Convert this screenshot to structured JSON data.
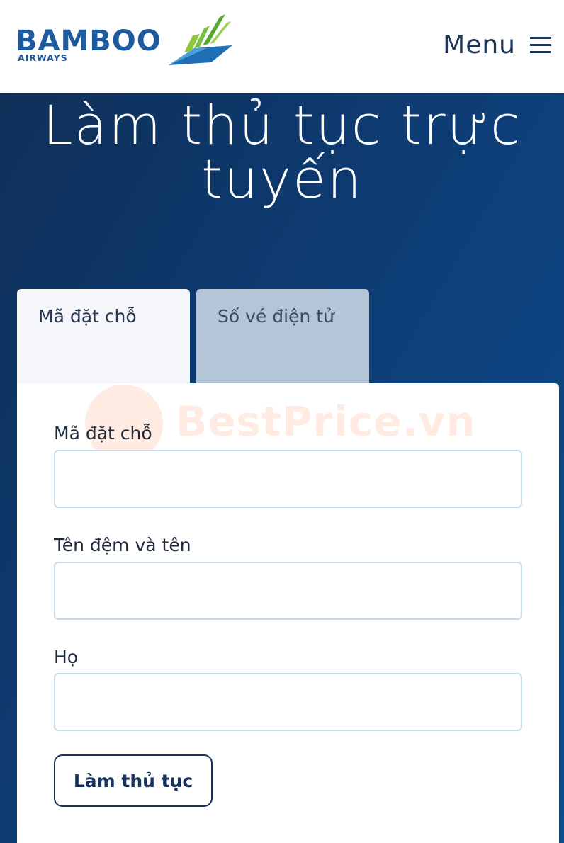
{
  "header": {
    "logo_word": "BAMBOO",
    "logo_sub": "AIRWAYS",
    "menu_label": "Menu"
  },
  "hero": {
    "title_line1": "Làm thủ tục trực",
    "title_line2": "tuyến"
  },
  "tabs": [
    {
      "label": "Mã đặt chỗ",
      "active": true
    },
    {
      "label": "Số vé điện tử",
      "active": false
    }
  ],
  "watermark": {
    "text": "BestPrice.vn"
  },
  "form": {
    "fields": [
      {
        "label": "Mã đặt chỗ",
        "value": ""
      },
      {
        "label": "Tên đệm và tên",
        "value": ""
      },
      {
        "label": "Họ",
        "value": ""
      }
    ],
    "submit_label": "Làm thủ tục"
  },
  "colors": {
    "brand_blue": "#1e5b9e",
    "hero_dark": "#0f2f58",
    "hero_light": "#0c4e8e",
    "tab_inactive": "#b5c5d8",
    "logo_green": "#7ac143",
    "watermark_orange": "#ff6a2b"
  }
}
